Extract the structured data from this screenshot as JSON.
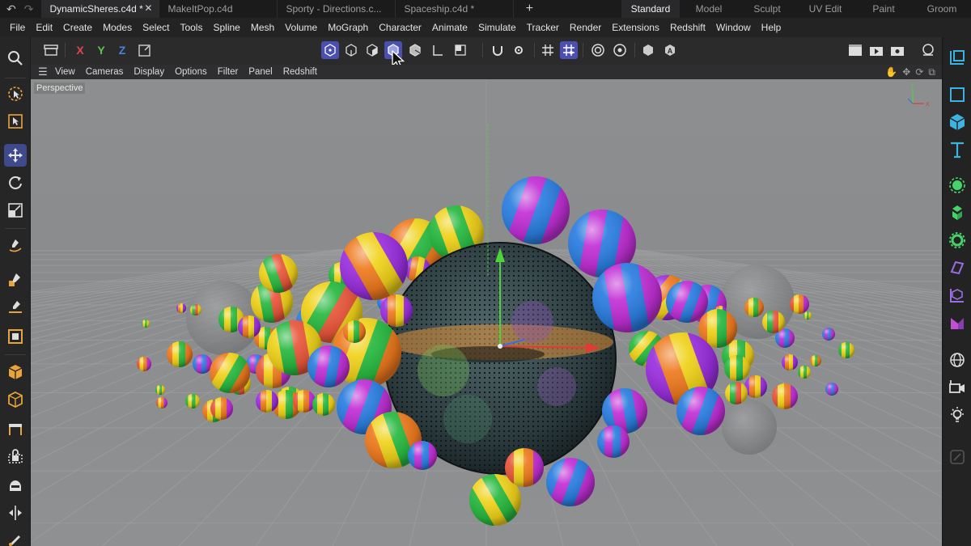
{
  "tabbar": {
    "nav_back": "↶",
    "nav_forward": "↷",
    "tabs": [
      {
        "label": "DynamicSheres.c4d *",
        "close": "✕"
      },
      {
        "label": "MakeItPop.c4d"
      },
      {
        "label": "Sporty - Directions.c..."
      },
      {
        "label": "Spaceship.c4d *"
      }
    ],
    "add_tab": "+",
    "layouts": [
      "Standard",
      "Model",
      "Sculpt",
      "UV Edit",
      "Paint",
      "Groom"
    ]
  },
  "menubar": {
    "items": [
      "File",
      "Edit",
      "Create",
      "Modes",
      "Select",
      "Tools",
      "Spline",
      "Mesh",
      "Volume",
      "MoGraph",
      "Character",
      "Animate",
      "Simulate",
      "Tracker",
      "Render",
      "Extensions",
      "Redshift",
      "Window",
      "Help"
    ]
  },
  "toolbar": {
    "axis_x": "X",
    "axis_y": "Y",
    "axis_z": "Z",
    "axis_x_color": "#e0474a",
    "axis_y_color": "#58c84a",
    "axis_z_color": "#4a82e0",
    "selection_color": "#4a4fb0"
  },
  "viewport_menu": {
    "items": [
      "View",
      "Cameras",
      "Display",
      "Options",
      "Filter",
      "Panel",
      "Redshift"
    ]
  },
  "viewport": {
    "camera_label": "Perspective",
    "background_color": "#888a8c",
    "grid_color": "#a3a5a7"
  }
}
